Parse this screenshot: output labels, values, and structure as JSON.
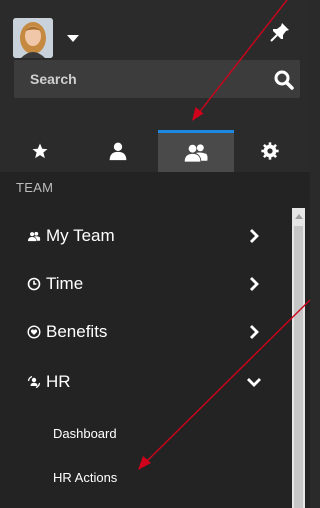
{
  "header": {
    "avatar_icon": "user-avatar",
    "menu_icon": "caret-down-icon",
    "pin_icon": "pin-icon"
  },
  "search": {
    "placeholder": "Search",
    "icon": "search-icon"
  },
  "tabs": [
    {
      "icon": "star-icon",
      "active": false
    },
    {
      "icon": "person-icon",
      "active": false
    },
    {
      "icon": "team-icon",
      "active": true
    },
    {
      "icon": "gear-icon",
      "active": false
    }
  ],
  "nav": {
    "section_title": "TEAM",
    "items": [
      {
        "label": "My Team",
        "icon": "team-icon",
        "expanded": false
      },
      {
        "label": "Time",
        "icon": "clock-icon",
        "expanded": false
      },
      {
        "label": "Benefits",
        "icon": "heart-icon",
        "expanded": false
      },
      {
        "label": "HR",
        "icon": "hr-icon",
        "expanded": true
      }
    ],
    "subitems": [
      {
        "label": "Dashboard"
      },
      {
        "label": "HR Actions"
      }
    ]
  },
  "colors": {
    "background": "#232323",
    "header": "#2b2b2b",
    "active_tab": "#4a4a4a",
    "accent": "#1e88e5",
    "annotation_arrow": "#d0021b"
  }
}
